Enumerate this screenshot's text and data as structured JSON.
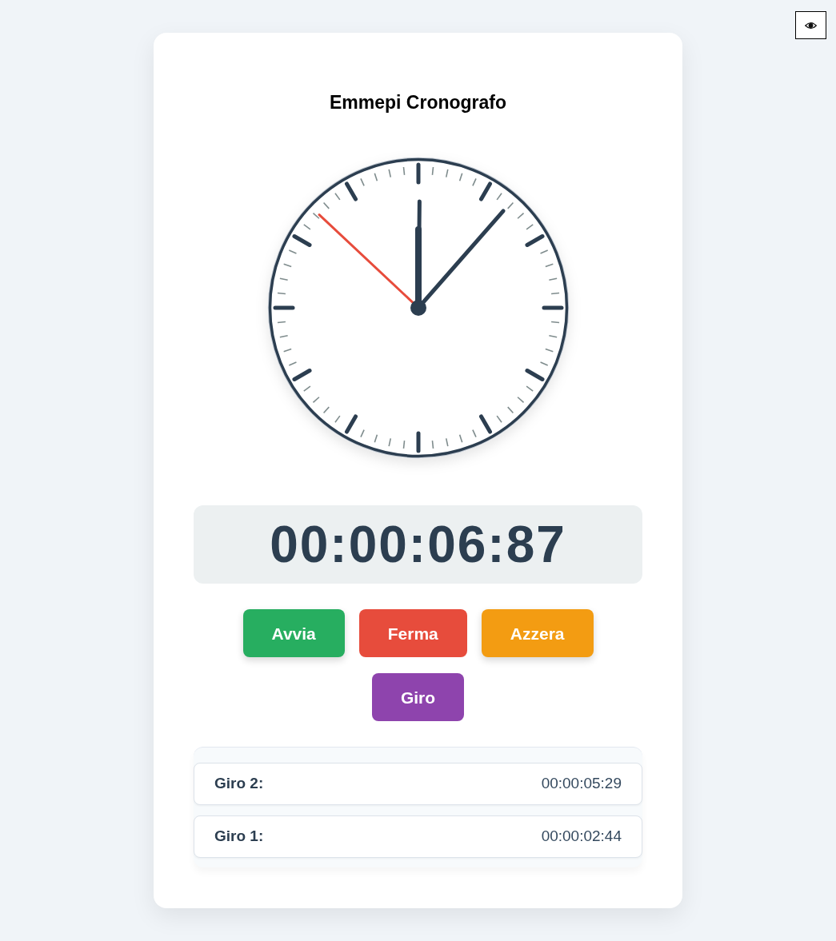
{
  "title": "Emmepi Cronografo",
  "display": {
    "time": "00:00:06:87"
  },
  "buttons": [
    {
      "label": "Avvia",
      "color": "#27ae60",
      "raised": true
    },
    {
      "label": "Ferma",
      "color": "#e74c3c",
      "raised": false
    },
    {
      "label": "Azzera",
      "color": "#f39c12",
      "raised": true
    },
    {
      "label": "Giro",
      "color": "#8e44ad",
      "raised": false
    }
  ],
  "laps": [
    {
      "label": "Giro 2:",
      "time": "00:00:05:29"
    },
    {
      "label": "Giro 1:",
      "time": "00:00:02:44"
    }
  ]
}
